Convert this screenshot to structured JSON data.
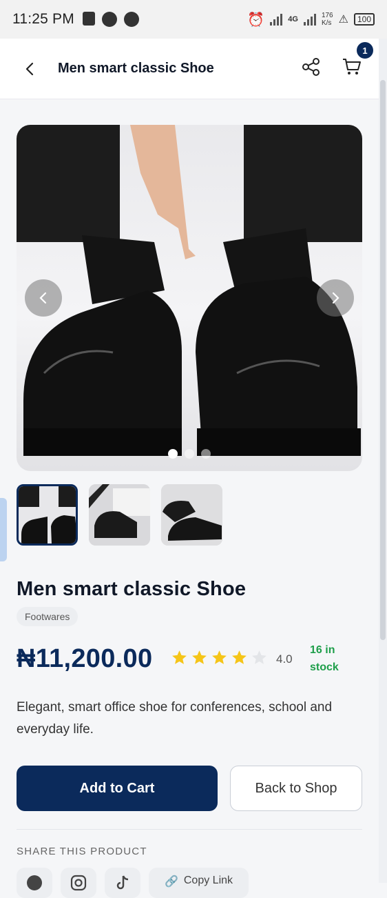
{
  "status_bar": {
    "time": "11:25 PM",
    "net_speed": "176\nK/s",
    "battery": "100",
    "network": "4G"
  },
  "header": {
    "title": "Men smart classic Shoe",
    "cart_count": "1"
  },
  "product": {
    "name": "Men smart classic Shoe",
    "category": "Footwares",
    "price": "₦11,200.00",
    "rating": 4.0,
    "rating_text": "4.0",
    "stock": "16 in stock",
    "description": "Elegant, smart office shoe for conferences, school and everyday life."
  },
  "gallery": {
    "image_count": 3,
    "active_index": 0
  },
  "actions": {
    "add_to_cart": "Add to Cart",
    "back_to_shop": "Back to Shop"
  },
  "share": {
    "label": "SHARE THIS PRODUCT",
    "copy_link": "Copy Link"
  },
  "colors": {
    "primary": "#0b2a5b",
    "stock_green": "#1e9e4a",
    "star": "#f5c518"
  }
}
